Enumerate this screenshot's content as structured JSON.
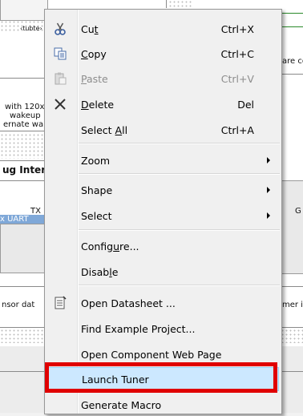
{
  "background": {
    "frag_top": "‹tubte›",
    "frag_ware_con": "are co",
    "frag_with_120": "with 120x",
    "frag_wakeup": "wakeup",
    "frag_ernate": "ernate wa",
    "frag_ug_inter": "ug Inter",
    "frag_tx": "TX",
    "frag_x_uart": "x UART",
    "frag_g": "G",
    "frag_nsor_dat": "nsor dat",
    "frag_mer_in": "mer in"
  },
  "menu": {
    "items": [
      {
        "label": "Cut",
        "shortcut": "Ctrl+X",
        "icon": "scissors-icon"
      },
      {
        "label": "Copy",
        "shortcut": "Ctrl+C",
        "icon": "copy-icon"
      },
      {
        "label": "Paste",
        "shortcut": "Ctrl+V",
        "icon": "paste-icon",
        "disabled": true
      },
      {
        "label": "Delete",
        "shortcut": "Del",
        "icon": "delete-x-icon"
      },
      {
        "label": "Select All",
        "shortcut": "Ctrl+A"
      },
      {
        "label": "Zoom",
        "submenu": true
      },
      {
        "label": "Shape",
        "submenu": true
      },
      {
        "label": "Select",
        "submenu": true
      },
      {
        "label": "Configure..."
      },
      {
        "label": "Disable"
      },
      {
        "label": "Open Datasheet ...",
        "icon": "datasheet-icon"
      },
      {
        "label": "Find Example Project..."
      },
      {
        "label": "Open Component Web Page"
      },
      {
        "label": "Launch Tuner",
        "highlighted": true
      },
      {
        "label": "Generate Macro"
      }
    ]
  },
  "colors": {
    "highlight_bg": "#cce8ff",
    "highlight_border": "#99d1ff",
    "annotation_red": "#e00000",
    "menu_bg": "#f0f0f0"
  }
}
